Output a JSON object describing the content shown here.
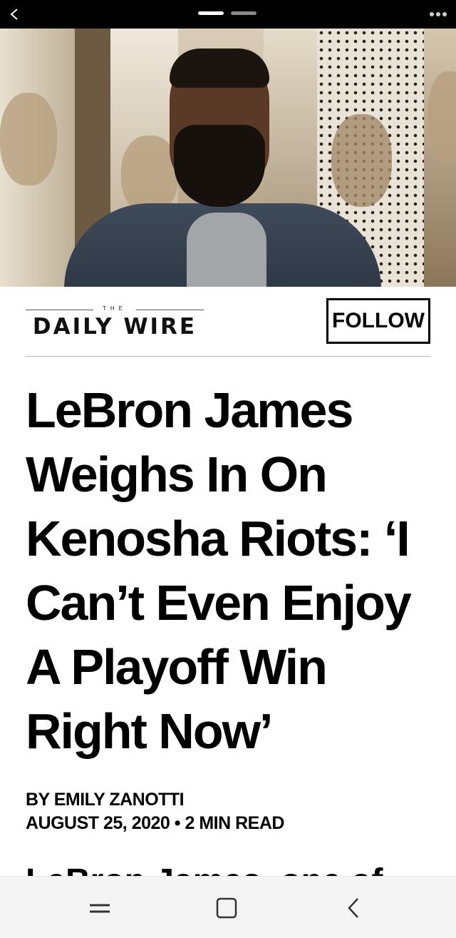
{
  "topbar": {
    "back_icon": "chevron-left-icon",
    "pages": [
      {
        "state": "active"
      },
      {
        "state": "inactive"
      }
    ],
    "more_icon": "more-dots-icon"
  },
  "hero": {
    "image": "photo of man with beard in grey suit and t-shirt in front of portraits"
  },
  "masthead": {
    "logo_small": "THE",
    "logo_main": "DAILY WIRE",
    "follow_label": "FOLLOW"
  },
  "article": {
    "headline": "LeBron James Weighs In On Kenosha Riots: ‘I Can’t Even Enjoy A Playoff Win Right Now’",
    "author": "BY EMILY ZANOTTI",
    "date": "AUGUST 25, 2020",
    "separator": "•",
    "read_time": "2 MIN READ",
    "body_start": "LeBron James, one of the"
  },
  "navbar": {
    "recent_icon": "recent-apps-icon",
    "home_icon": "home-square-icon",
    "back_icon": "back-chevron-icon"
  },
  "colors": {
    "topbar_bg": "#000000",
    "navbar_bg": "#f4f4f4",
    "text": "#000000"
  }
}
